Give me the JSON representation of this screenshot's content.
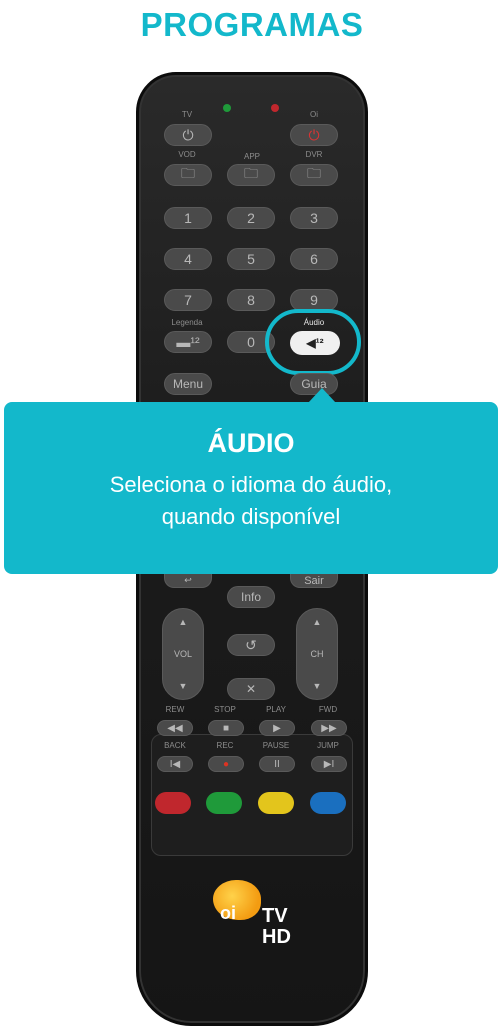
{
  "page_title": "PROGRAMAS",
  "remote": {
    "tv_label": "TV",
    "oi_label": "Oi",
    "vod_label": "VOD",
    "app_label": "APP",
    "dvr_label": "DVR",
    "digits": [
      "1",
      "2",
      "3",
      "4",
      "5",
      "6",
      "7",
      "8",
      "9",
      "0"
    ],
    "legenda_label": "Legenda",
    "audio_label": "Áudio",
    "menu_label": "Menu",
    "guia_label": "Guia",
    "sair_label": "Sair",
    "info_label": "Info",
    "vol_label": "VOL",
    "ch_label": "CH",
    "rew_label": "REW",
    "stop_label": "STOP",
    "play_label": "PLAY",
    "fwd_label": "FWD",
    "back_label": "BACK",
    "rec_label": "REC",
    "pause_label": "PAUSE",
    "jump_label": "JUMP",
    "brand_oi": "oi",
    "brand_tv": "TV",
    "brand_hd": "HD",
    "power_icon": "⏻",
    "audio_icon": "◀¹²",
    "legenda_icon": "▬¹²",
    "return_icon": "↺",
    "mute_icon": "🔇",
    "up_arrow": "▲",
    "down_arrow": "▼",
    "rew_icon": "◀◀",
    "stop_icon": "■",
    "play_icon": "▶",
    "fwd_icon": "▶▶",
    "back_icon": "I◀",
    "rec_icon": "●",
    "pause_icon": "II",
    "jump_icon": "▶I"
  },
  "callout": {
    "title": "ÁUDIO",
    "line1": "Seleciona o idioma do áudio,",
    "line2": "quando disponível"
  },
  "colors": {
    "accent": "#13b8cb",
    "red": "#c0272d",
    "green": "#1f9a3a",
    "yellow": "#e3c51c",
    "blue": "#1a6fbf"
  }
}
